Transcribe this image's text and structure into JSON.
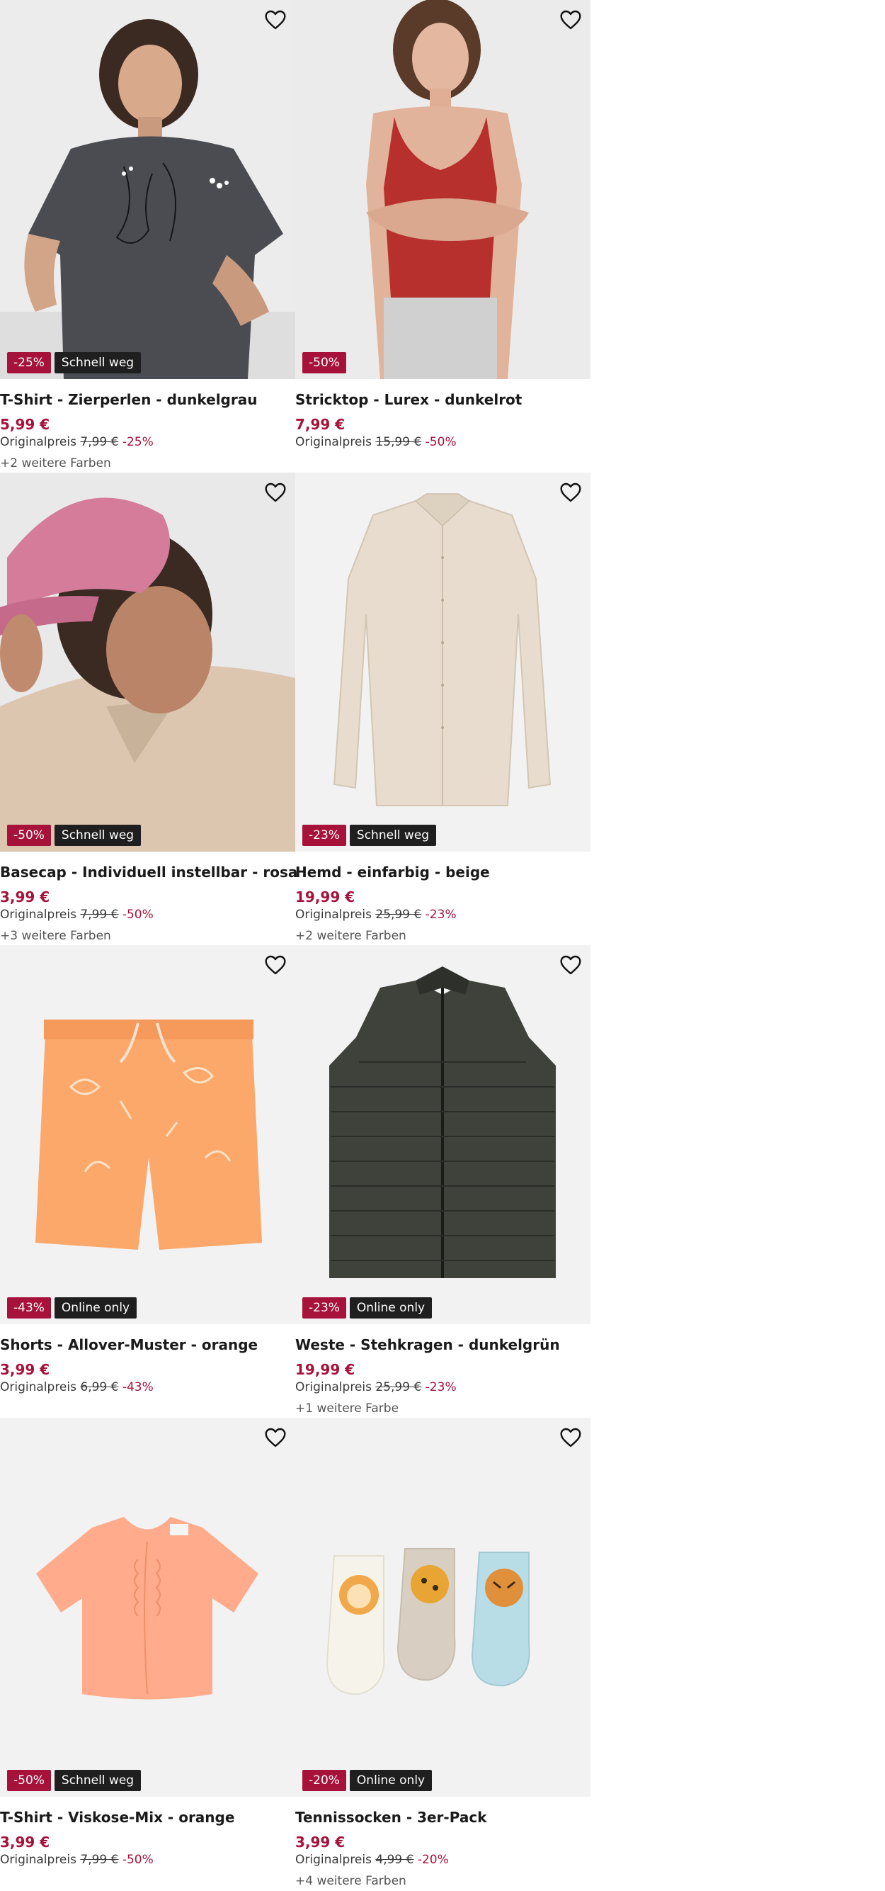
{
  "colors": {
    "accent": "#a6123a",
    "badge_dark": "#1f1f1f",
    "tile_bg": "#f2f2f2"
  },
  "products": [
    {
      "title": "T-Shirt - Zierperlen - dunkelgrau",
      "price": "5,99 €",
      "orig_label": "Originalpreis",
      "orig_price": "7,99 €",
      "orig_pct": "-25%",
      "discount": "-25%",
      "tag": "Schnell weg",
      "more_colors": "+2 weitere Farben",
      "image": "model-grey-tshirt",
      "icon": "heart-outline-icon"
    },
    {
      "title": "Stricktop - Lurex - dunkelrot",
      "price": "7,99 €",
      "orig_label": "Originalpreis",
      "orig_price": "15,99 €",
      "orig_pct": "-50%",
      "discount": "-50%",
      "tag": "",
      "more_colors": "",
      "image": "model-red-knit-top",
      "icon": "heart-outline-icon"
    },
    {
      "title": "Basecap - Individuell instellbar - rosa",
      "price": "3,99 €",
      "orig_label": "Originalpreis",
      "orig_price": "7,99 €",
      "orig_pct": "-50%",
      "discount": "-50%",
      "tag": "Schnell weg",
      "more_colors": "+3 weitere Farben",
      "image": "model-pink-cap",
      "icon": "heart-outline-icon"
    },
    {
      "title": "Hemd - einfarbig - beige",
      "price": "19,99 €",
      "orig_label": "Originalpreis",
      "orig_price": "25,99 €",
      "orig_pct": "-23%",
      "discount": "-23%",
      "tag": "Schnell weg",
      "more_colors": "+2 weitere Farben",
      "image": "beige-shirt",
      "icon": "heart-outline-icon"
    },
    {
      "title": "Shorts - Allover-Muster - orange",
      "price": "3,99 €",
      "orig_label": "Originalpreis",
      "orig_price": "6,99 €",
      "orig_pct": "-43%",
      "discount": "-43%",
      "tag": "Online only",
      "more_colors": "",
      "image": "orange-shorts",
      "icon": "heart-outline-icon"
    },
    {
      "title": "Weste - Stehkragen - dunkelgrün",
      "price": "19,99 €",
      "orig_label": "Originalpreis",
      "orig_price": "25,99 €",
      "orig_pct": "-23%",
      "discount": "-23%",
      "tag": "Online only",
      "more_colors": "+1 weitere Farbe",
      "image": "green-puffer-vest",
      "icon": "heart-outline-icon"
    },
    {
      "title": "T-Shirt - Viskose-Mix - orange",
      "price": "3,99 €",
      "orig_label": "Originalpreis",
      "orig_price": "7,99 €",
      "orig_pct": "-50%",
      "discount": "-50%",
      "tag": "Schnell weg",
      "more_colors": "",
      "image": "peach-tshirt",
      "icon": "heart-outline-icon"
    },
    {
      "title": "Tennissocken - 3er-Pack",
      "price": "3,99 €",
      "orig_label": "Originalpreis",
      "orig_price": "4,99 €",
      "orig_pct": "-20%",
      "discount": "-20%",
      "tag": "Online only",
      "more_colors": "+4 weitere Farben",
      "image": "kids-socks-3pack",
      "icon": "heart-outline-icon"
    }
  ]
}
